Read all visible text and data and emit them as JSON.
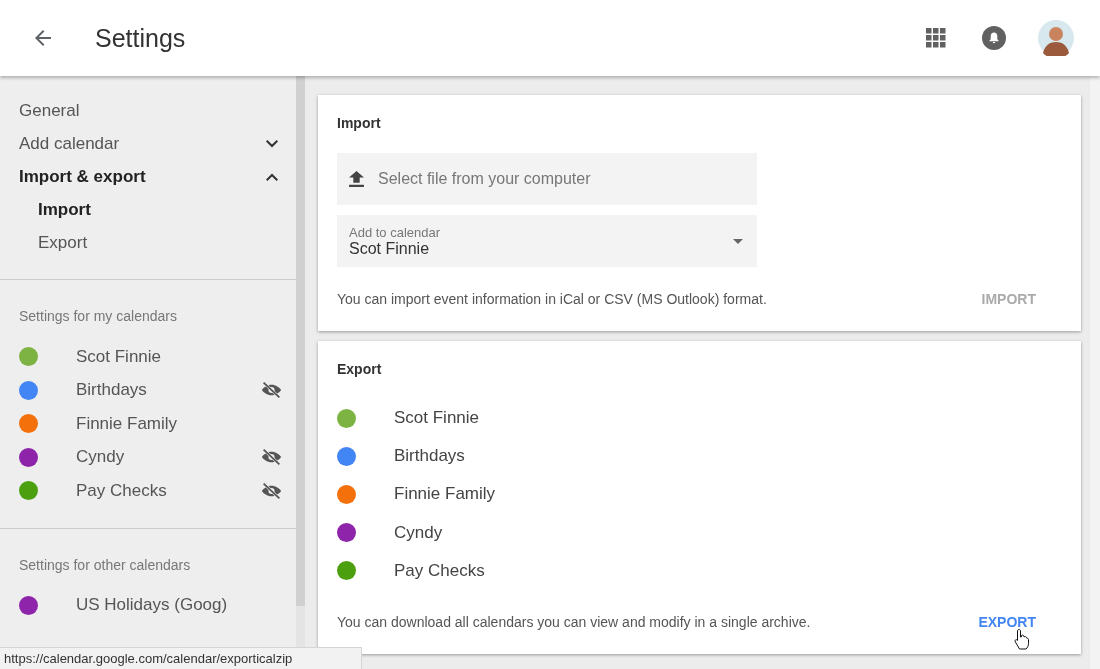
{
  "header": {
    "title": "Settings"
  },
  "sidebar": {
    "items": [
      {
        "label": "General"
      },
      {
        "label": "Add calendar",
        "expanded": false
      },
      {
        "label": "Import & export",
        "expanded": true,
        "children": [
          {
            "label": "Import",
            "selected": true
          },
          {
            "label": "Export",
            "selected": false
          }
        ]
      }
    ],
    "my_calendars": {
      "heading": "Settings for my calendars",
      "items": [
        {
          "name": "Scot Finnie",
          "color": "#7cb342",
          "hidden": false
        },
        {
          "name": "Birthdays",
          "color": "#4285f4",
          "hidden": true
        },
        {
          "name": "Finnie Family",
          "color": "#f4700b",
          "hidden": false
        },
        {
          "name": "Cyndy",
          "color": "#8e24aa",
          "hidden": true
        },
        {
          "name": "Pay Checks",
          "color": "#4ca010",
          "hidden": true
        }
      ]
    },
    "other_calendars": {
      "heading": "Settings for other calendars",
      "items": [
        {
          "name": "US Holidays (Goog)",
          "color": "#8e24aa",
          "hidden": false
        }
      ]
    }
  },
  "import": {
    "title": "Import",
    "file_placeholder": "Select file from your computer",
    "calendar_label": "Add to calendar",
    "calendar_value": "Scot Finnie",
    "note": "You can import event information in iCal or CSV (MS Outlook) format.",
    "button": "IMPORT",
    "button_disabled": true
  },
  "export": {
    "title": "Export",
    "items": [
      {
        "name": "Scot Finnie",
        "color": "#7cb342"
      },
      {
        "name": "Birthdays",
        "color": "#4285f4"
      },
      {
        "name": "Finnie Family",
        "color": "#f4700b"
      },
      {
        "name": "Cyndy",
        "color": "#8e24aa"
      },
      {
        "name": "Pay Checks",
        "color": "#4ca010"
      }
    ],
    "note": "You can download all calendars you can view and modify in a single archive.",
    "button": "EXPORT",
    "button_disabled": false
  },
  "status_url": "https://calendar.google.com/calendar/exporticalzip"
}
